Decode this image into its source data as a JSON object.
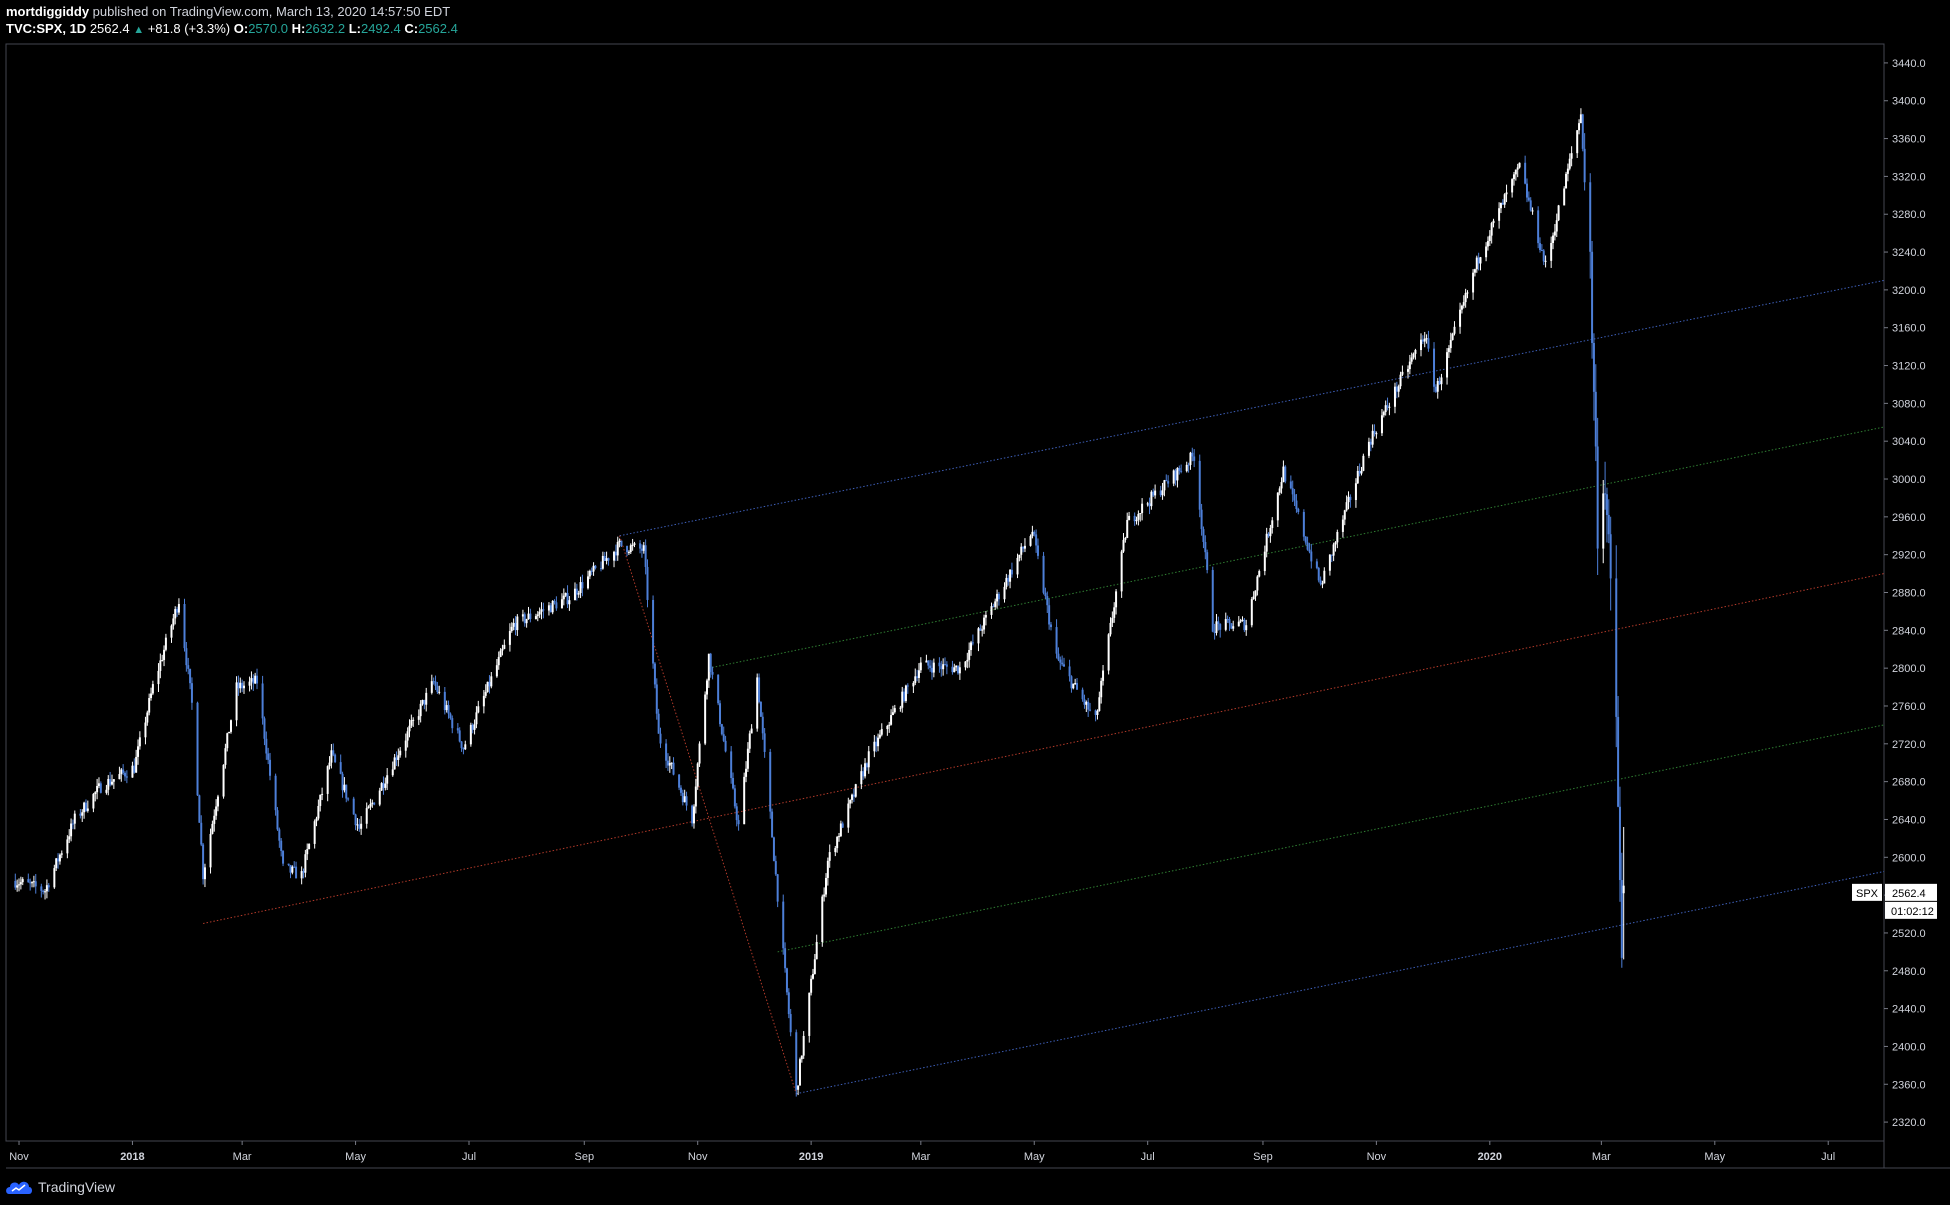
{
  "header": {
    "author": "mortdiggiddy",
    "published_text": "published on TradingView.com, March 13, 2020 14:57:50 EDT",
    "symbol": "TVC:SPX, 1D",
    "last": "2562.4",
    "change": "+81.8 (+3.3%)",
    "open_label": "O:",
    "open": "2570.0",
    "high_label": "H:",
    "high": "2632.2",
    "low_label": "L:",
    "low": "2492.4",
    "close_label": "C:",
    "close": "2562.4"
  },
  "price_tag": {
    "symbol": "SPX",
    "price": "2562.4",
    "countdown": "01:02:12"
  },
  "footer": {
    "brand": "TradingView"
  },
  "colors": {
    "background": "#000000",
    "up": "#ffffff",
    "down": "#4d7fd8",
    "blue_line": "#3e5fb8",
    "green_line": "#2f7d32",
    "red_line": "#b23a2a",
    "axis_text": "#d1d4dc"
  },
  "chart_data": {
    "type": "candlestick",
    "ylim": [
      2300,
      3460
    ],
    "y_ticks": [
      2320,
      2360,
      2400,
      2440,
      2480,
      2520,
      2560,
      2600,
      2640,
      2680,
      2720,
      2760,
      2800,
      2840,
      2880,
      2920,
      2960,
      3000,
      3040,
      3080,
      3120,
      3160,
      3200,
      3240,
      3280,
      3320,
      3360,
      3400,
      3440
    ],
    "x_ticks": [
      {
        "label": "Nov",
        "date": "2017-11-01"
      },
      {
        "label": "2018",
        "date": "2018-01-01"
      },
      {
        "label": "Mar",
        "date": "2018-03-01"
      },
      {
        "label": "May",
        "date": "2018-05-01"
      },
      {
        "label": "Jul",
        "date": "2018-07-01"
      },
      {
        "label": "Sep",
        "date": "2018-09-01"
      },
      {
        "label": "Nov",
        "date": "2018-11-01"
      },
      {
        "label": "2019",
        "date": "2019-01-01"
      },
      {
        "label": "Mar",
        "date": "2019-03-01"
      },
      {
        "label": "May",
        "date": "2019-05-01"
      },
      {
        "label": "Jul",
        "date": "2019-07-01"
      },
      {
        "label": "Sep",
        "date": "2019-09-01"
      },
      {
        "label": "Nov",
        "date": "2019-11-01"
      },
      {
        "label": "2020",
        "date": "2020-01-01"
      },
      {
        "label": "Mar",
        "date": "2020-03-01"
      },
      {
        "label": "May",
        "date": "2020-05-01"
      },
      {
        "label": "Jul",
        "date": "2020-07-01"
      }
    ],
    "price_path": [
      [
        "2017-10-30",
        2575
      ],
      [
        "2017-11-15",
        2565
      ],
      [
        "2017-12-01",
        2640
      ],
      [
        "2017-12-15",
        2675
      ],
      [
        "2018-01-02",
        2695
      ],
      [
        "2018-01-12",
        2780
      ],
      [
        "2018-01-26",
        2872
      ],
      [
        "2018-02-02",
        2762
      ],
      [
        "2018-02-08",
        2582
      ],
      [
        "2018-02-26",
        2779
      ],
      [
        "2018-03-09",
        2786
      ],
      [
        "2018-03-23",
        2588
      ],
      [
        "2018-04-02",
        2581
      ],
      [
        "2018-04-18",
        2708
      ],
      [
        "2018-05-03",
        2630
      ],
      [
        "2018-06-12",
        2785
      ],
      [
        "2018-06-28",
        2716
      ],
      [
        "2018-07-25",
        2846
      ],
      [
        "2018-08-24",
        2875
      ],
      [
        "2018-09-20",
        2930
      ],
      [
        "2018-10-03",
        2925
      ],
      [
        "2018-10-11",
        2728
      ],
      [
        "2018-10-29",
        2641
      ],
      [
        "2018-11-07",
        2813
      ],
      [
        "2018-11-23",
        2633
      ],
      [
        "2018-12-03",
        2790
      ],
      [
        "2018-12-24",
        2351
      ],
      [
        "2019-01-10",
        2596
      ],
      [
        "2019-02-01",
        2706
      ],
      [
        "2019-03-01",
        2803
      ],
      [
        "2019-03-22",
        2800
      ],
      [
        "2019-04-30",
        2945
      ],
      [
        "2019-05-13",
        2811
      ],
      [
        "2019-06-03",
        2744
      ],
      [
        "2019-06-20",
        2954
      ],
      [
        "2019-07-26",
        3025
      ],
      [
        "2019-08-05",
        2844
      ],
      [
        "2019-08-23",
        2847
      ],
      [
        "2019-09-12",
        3009
      ],
      [
        "2019-10-02",
        2887
      ],
      [
        "2019-10-28",
        3039
      ],
      [
        "2019-11-27",
        3153
      ],
      [
        "2019-12-03",
        3093
      ],
      [
        "2019-12-27",
        3240
      ],
      [
        "2020-01-17",
        3330
      ],
      [
        "2020-01-31",
        3225
      ],
      [
        "2020-02-19",
        3386
      ],
      [
        "2020-02-24",
        3225
      ],
      [
        "2020-02-28",
        2954
      ],
      [
        "2020-03-03",
        3003
      ],
      [
        "2020-03-09",
        2746
      ],
      [
        "2020-03-12",
        2480
      ],
      [
        "2020-03-13",
        2562
      ]
    ],
    "lines": [
      {
        "name": "",
        "color_key": "blue_line",
        "from": [
          "2018-09-20",
          2940
        ],
        "to": [
          "2020-07-31",
          3210
        ]
      },
      {
        "name": "",
        "color_key": "green_line",
        "from": [
          "2018-11-07",
          2800
        ],
        "to": [
          "2020-07-31",
          3055
        ]
      },
      {
        "name": "",
        "color_key": "red_line",
        "from": [
          "2018-02-08",
          2530
        ],
        "to": [
          "2020-07-31",
          2900
        ]
      },
      {
        "name": "",
        "color_key": "green_line",
        "from": [
          "2018-12-14",
          2500
        ],
        "to": [
          "2020-07-31",
          2740
        ]
      },
      {
        "name": "",
        "color_key": "blue_line",
        "from": [
          "2018-12-24",
          2350
        ],
        "to": [
          "2020-07-31",
          2585
        ]
      },
      {
        "name": "",
        "color_key": "red_line",
        "from": [
          "2018-09-20",
          2940
        ],
        "to": [
          "2018-12-24",
          2350
        ]
      }
    ]
  }
}
